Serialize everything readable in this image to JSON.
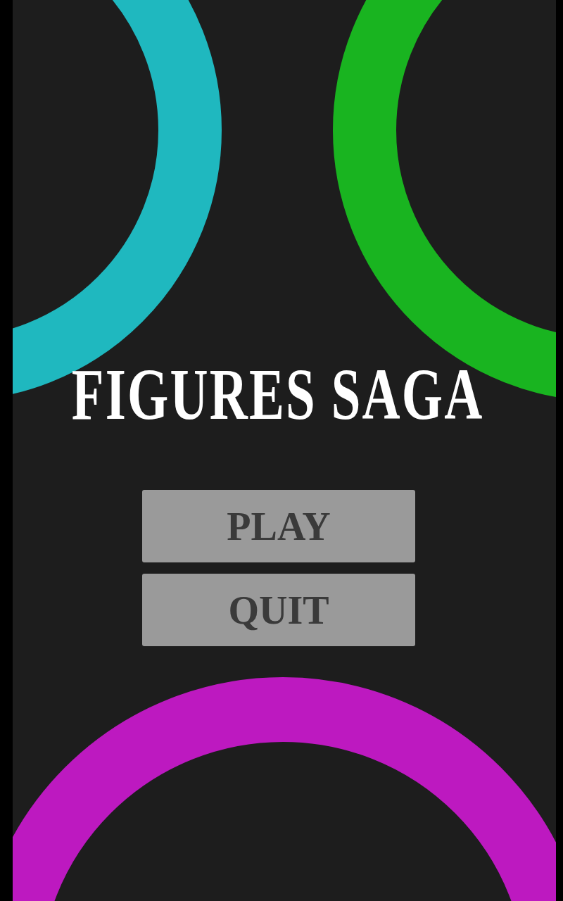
{
  "title": "FIGURES SAGA",
  "buttons": [
    {
      "label": "PLAY"
    },
    {
      "label": "QUIT"
    }
  ]
}
